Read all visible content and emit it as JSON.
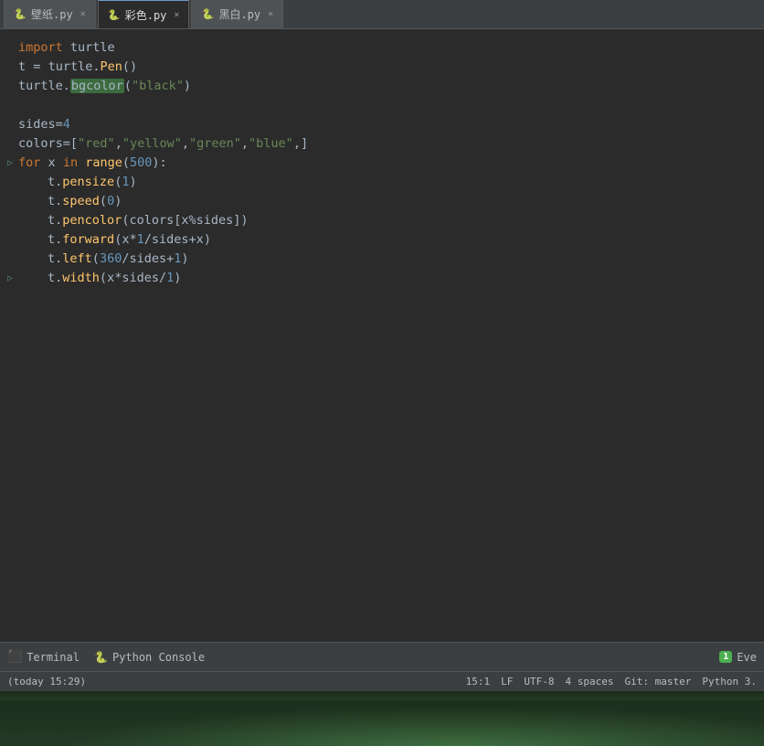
{
  "tabs": [
    {
      "id": "tab1",
      "label": "壁纸.py",
      "icon": "py-gray",
      "active": false
    },
    {
      "id": "tab2",
      "label": "彩色.py",
      "icon": "py-green",
      "active": true
    },
    {
      "id": "tab3",
      "label": "黑白.py",
      "icon": "py-gray",
      "active": false
    }
  ],
  "code_lines": [
    {
      "indent": 0,
      "gutter": "",
      "html": "<span class='kw'>import</span> <span class='var'>turtle</span>"
    },
    {
      "indent": 0,
      "gutter": "",
      "html": "<span class='var'>t</span> <span class='op'>=</span> <span class='var'>turtle</span>.<span class='fn'>Pen</span><span class='op'>()</span>"
    },
    {
      "indent": 0,
      "gutter": "",
      "html": "<span class='var'>turtle</span>.<span class='hl-bg'>bgcolor</span><span class='op'>(</span><span class='str'>\"black\"</span><span class='op'>)</span>"
    },
    {
      "indent": 0,
      "gutter": "",
      "html": ""
    },
    {
      "indent": 0,
      "gutter": "",
      "html": "<span class='var'>sides</span><span class='op'>=</span><span class='num'>4</span>"
    },
    {
      "indent": 0,
      "gutter": "",
      "html": "<span class='var'>colors</span><span class='op'>=[</span><span class='str'>\"red\"</span><span class='op'>,</span><span class='str'>\"yellow\"</span><span class='op'>,</span><span class='str'>\"green\"</span><span class='op'>,</span><span class='str'>\"blue\"</span><span class='op'>,</span><span class='op'>]</span>"
    },
    {
      "indent": 0,
      "gutter": "▷",
      "html": "<span class='kw'>for</span> <span class='var'>x</span> <span class='kw'>in</span> <span class='fn'>range</span><span class='op'>(</span><span class='num'>500</span><span class='op'>):</span>"
    },
    {
      "indent": 1,
      "gutter": "",
      "html": "<span class='var'>t</span>.<span class='fn'>pensize</span><span class='op'>(</span><span class='num'>1</span><span class='op'>)</span>"
    },
    {
      "indent": 1,
      "gutter": "",
      "html": "<span class='var'>t</span>.<span class='fn'>speed</span><span class='op'>(</span><span class='num'>0</span><span class='op'>)</span>"
    },
    {
      "indent": 1,
      "gutter": "",
      "html": "<span class='var'>t</span>.<span class='fn'>pencolor</span><span class='op'>(</span><span class='var'>colors</span><span class='op'>[</span><span class='var'>x</span><span class='op'>%</span><span class='var'>sides</span><span class='op'>])</span>"
    },
    {
      "indent": 1,
      "gutter": "",
      "html": "<span class='var'>t</span>.<span class='fn'>forward</span><span class='op'>(</span><span class='var'>x</span><span class='op'>*</span><span class='num'>1</span><span class='op'>/</span><span class='var'>sides</span><span class='op'>+</span><span class='var'>x</span><span class='op'>)</span>"
    },
    {
      "indent": 1,
      "gutter": "",
      "html": "<span class='var'>t</span>.<span class='fn'>left</span><span class='op'>(</span><span class='num'>360</span><span class='op'>/</span><span class='var'>sides</span><span class='op'>+</span><span class='num'>1</span><span class='op'>)</span>"
    },
    {
      "indent": 1,
      "gutter": "▷",
      "html": "<span class='var'>t</span>.<span class='fn'>width</span><span class='op'>(</span><span class='var'>x</span><span class='op'>*</span><span class='var'>sides</span><span class='op'>/</span><span class='num'>1</span><span class='op'>)</span>"
    }
  ],
  "bottom_toolbar": {
    "terminal_label": "Terminal",
    "python_console_label": "Python Console",
    "badge": "1",
    "eve_label": "Eve"
  },
  "status_bar": {
    "position": "15:1",
    "line_ending": "LF",
    "encoding": "UTF-8",
    "indent": "4 spaces",
    "vcs": "Git: master",
    "python": "Python 3.",
    "timestamp": "(today 15:29)"
  }
}
